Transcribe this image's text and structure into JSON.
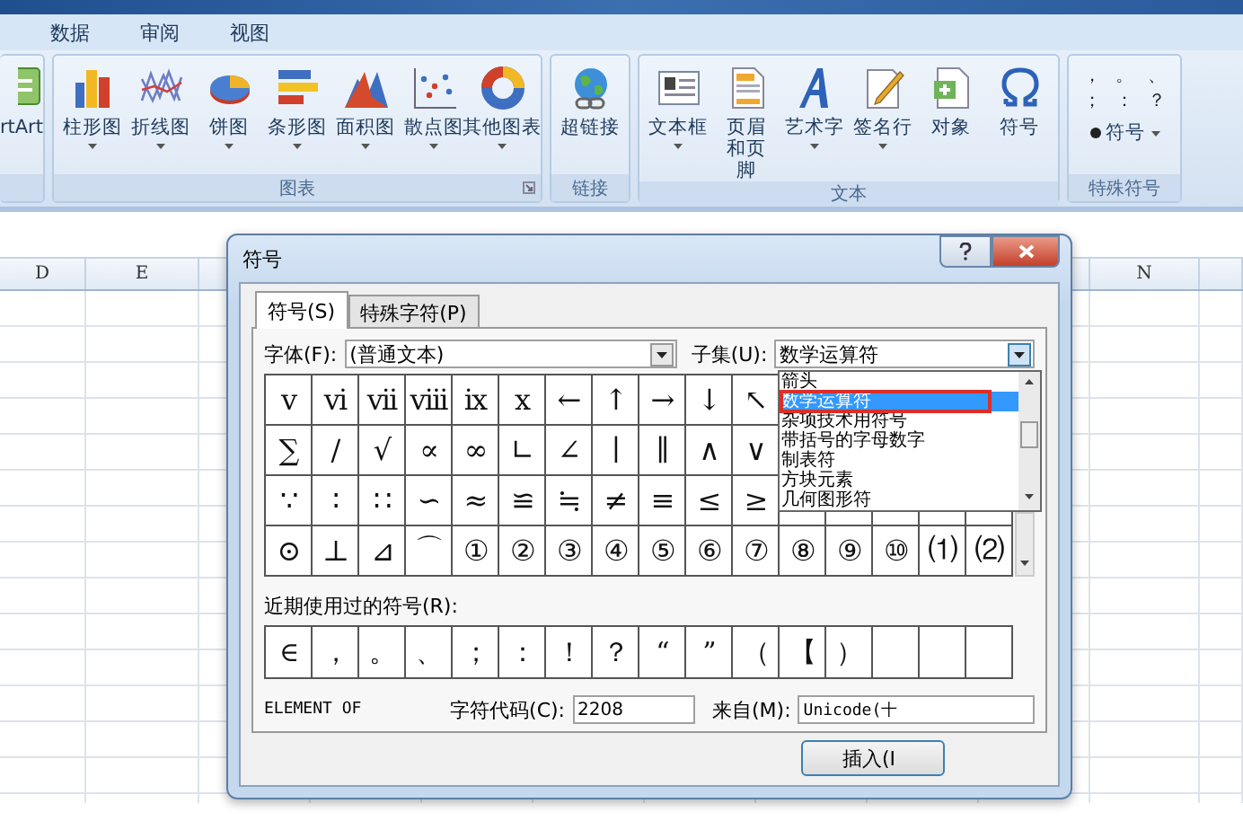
{
  "menu_tabs": [
    {
      "label": "数据",
      "selected": false
    },
    {
      "label": "审阅",
      "selected": false
    },
    {
      "label": "视图",
      "selected": false
    }
  ],
  "ribbon": {
    "partial_group": {
      "label": "rtArt"
    },
    "groups": [
      {
        "label": "图表",
        "buttons": [
          {
            "label": "柱形图",
            "has_menu": true
          },
          {
            "label": "折线图",
            "has_menu": true
          },
          {
            "label": "饼图",
            "has_menu": true
          },
          {
            "label": "条形图",
            "has_menu": true
          },
          {
            "label": "面积图",
            "has_menu": true
          },
          {
            "label": "散点图",
            "has_menu": true
          },
          {
            "label": "其他图表",
            "has_menu": true
          }
        ],
        "launcher": true
      },
      {
        "label": "链接",
        "buttons": [
          {
            "label": "超链接",
            "has_menu": false
          }
        ]
      },
      {
        "label": "文本",
        "buttons": [
          {
            "label": "文本框",
            "has_menu": true
          },
          {
            "label": "页眉和页脚",
            "has_menu": false
          },
          {
            "label": "艺术字",
            "has_menu": true
          },
          {
            "label": "签名行",
            "has_menu": true
          },
          {
            "label": "对象",
            "has_menu": false
          },
          {
            "label": "符号",
            "has_menu": false
          }
        ]
      }
    ],
    "special_symbols": {
      "label": "特殊符号",
      "punctuation": [
        "，",
        "。",
        "、",
        "；",
        "：",
        "？"
      ],
      "button": {
        "label": "符号",
        "has_menu": true
      }
    }
  },
  "column_headers": [
    "D",
    "E",
    "N"
  ],
  "dialog": {
    "title": "符号",
    "tabs": [
      {
        "label": "符号(S)",
        "selected": true
      },
      {
        "label": "特殊字符(P)",
        "selected": false
      }
    ],
    "font_label": "字体(F):",
    "font_value": "(普通文本)",
    "subset_label": "子集(U):",
    "subset_value": "数学运算符",
    "subset_options": [
      {
        "label": "箭头",
        "selected": false
      },
      {
        "label": "数学运算符",
        "selected": true
      },
      {
        "label": "杂项技术用符号",
        "selected": false
      },
      {
        "label": "带括号的字母数字",
        "selected": false
      },
      {
        "label": "制表符",
        "selected": false
      },
      {
        "label": "方块元素",
        "selected": false
      },
      {
        "label": "几何图形符",
        "selected": false
      }
    ],
    "symbol_rows": [
      [
        "v",
        "vi",
        "vii",
        "viii",
        "ix",
        "x",
        "←",
        "↑",
        "→",
        "↓",
        "↖"
      ],
      [
        "∑",
        "∕",
        "√",
        "∝",
        "∞",
        "∟",
        "∠",
        "∣",
        "∥",
        "∧",
        "∨"
      ],
      [
        "∵",
        "∶",
        "∷",
        "∽",
        "≈",
        "≌",
        "≒",
        "≠",
        "≡",
        "≤",
        "≥"
      ],
      [
        "⊙",
        "⊥",
        "⊿",
        "⌒",
        "①",
        "②",
        "③",
        "④",
        "⑤",
        "⑥",
        "⑦",
        "⑧",
        "⑨",
        "⑩",
        "⑴",
        "⑵"
      ]
    ],
    "recent_label": "近期使用过的符号(R):",
    "recent_symbols": [
      "∈",
      "，",
      "。",
      "、",
      "；",
      "：",
      "！",
      "？",
      "“",
      "”",
      "（",
      "【",
      "）"
    ],
    "char_name": "ELEMENT OF",
    "code_label": "字符代码(C):",
    "code_value": "2208",
    "from_label": "来自(M):",
    "from_value": "Unicode(十",
    "insert_button": "插入(I"
  }
}
